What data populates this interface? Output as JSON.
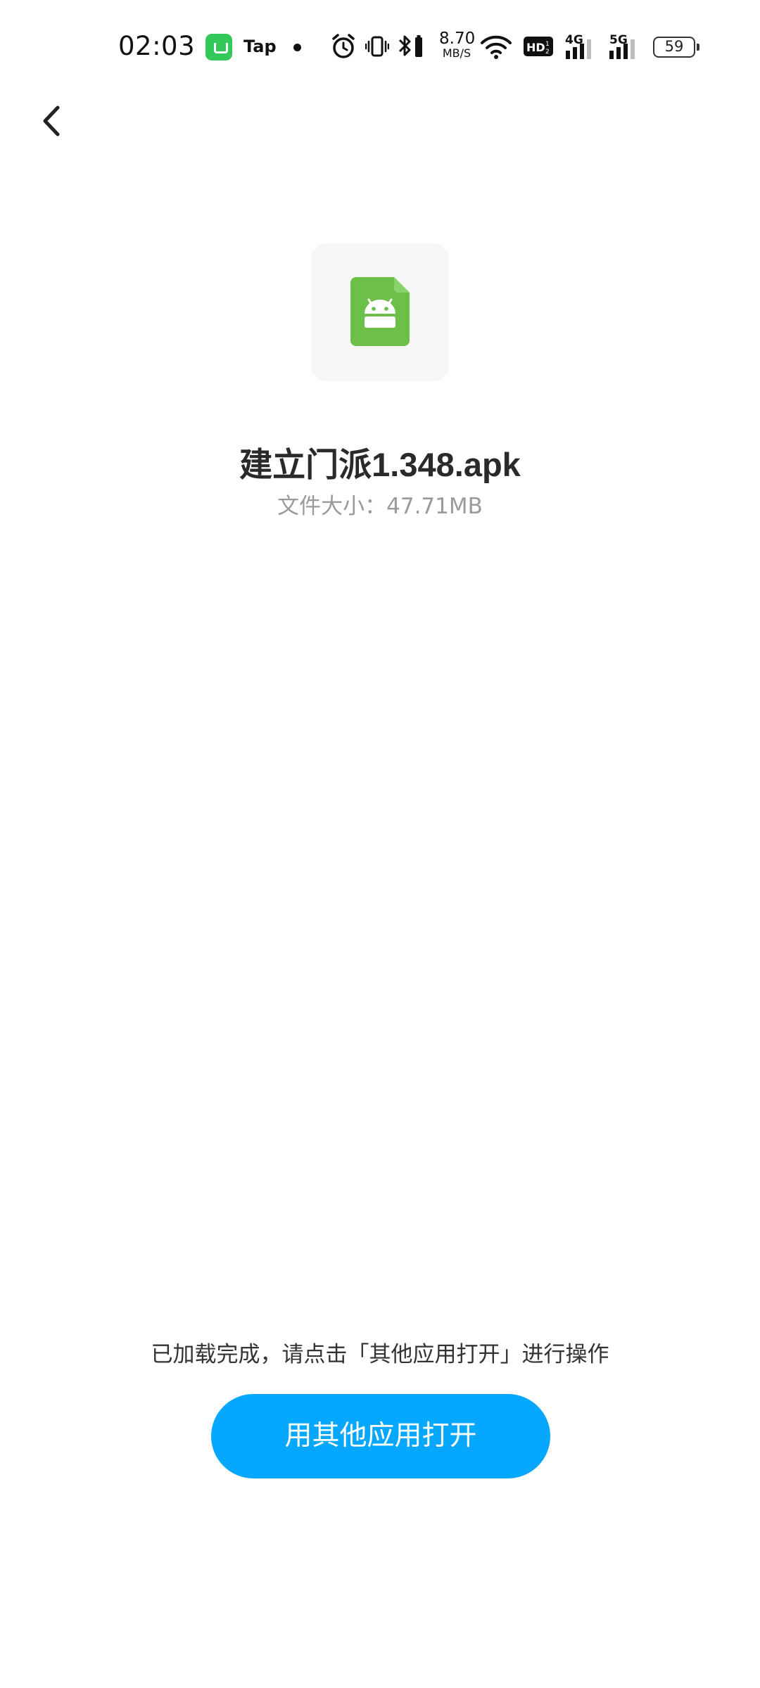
{
  "status_bar": {
    "time": "02:03",
    "app_label": "Tap",
    "net_speed_value": "8.70",
    "net_speed_unit": "MB/S",
    "sim1_label": "4G",
    "sim2_label": "5G",
    "battery": "59"
  },
  "icons": {
    "back": "chevron-left-icon",
    "file": "android-apk-file-icon"
  },
  "file": {
    "name": "建立门派1.348.apk",
    "size_line": "文件大小：47.71MB"
  },
  "footer": {
    "hint": "已加载完成，请点击「其他应用打开」进行操作",
    "open_button_label": "用其他应用打开"
  },
  "colors": {
    "accent": "#06a8ff",
    "file_icon": "#6cc04a"
  }
}
